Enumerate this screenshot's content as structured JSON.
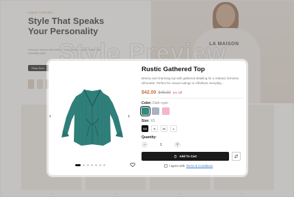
{
  "background": {
    "hero": {
      "tag": "Latest Collection",
      "title": "Style That Speaks Your Personality",
      "description": "Discover fashion that reflects your personality and effortless everyday style.",
      "button_label": "Shop Now →"
    },
    "hoodie_text": "LA MAISON",
    "watermark": "Style Preview"
  },
  "modal": {
    "gallery": {
      "dots_count": 7,
      "active_dot": 0
    },
    "product": {
      "title": "Rustic Gathered Top",
      "description": "Breezy and charming top with gathered detailing for a relaxed, feminine silhouette. Perfect for casual outings or effortless everyday...",
      "price": "$42.00",
      "old_price": "$49.00",
      "discount": "2% Off"
    },
    "color": {
      "label": "Color:",
      "selected": "Dark cyan",
      "swatches": [
        "#2e8a82",
        "#a8b4c0",
        "#f4b6c8"
      ],
      "selected_index": 0
    },
    "size": {
      "label": "Size:",
      "selected": "XS",
      "options": [
        "XS",
        "S",
        "M",
        "L"
      ],
      "selected_index": 0
    },
    "quantity": {
      "label": "Quantity:",
      "value": "1",
      "minus": "−",
      "plus": "+"
    },
    "add_to_cart_label": "Add To Cart",
    "agree": {
      "prefix": "I agree with",
      "link": "Terms & Conditions"
    }
  },
  "colors": {
    "accent_price": "#c76b3b",
    "discount": "#d94a4a",
    "cart_button": "#1a1a1a"
  }
}
